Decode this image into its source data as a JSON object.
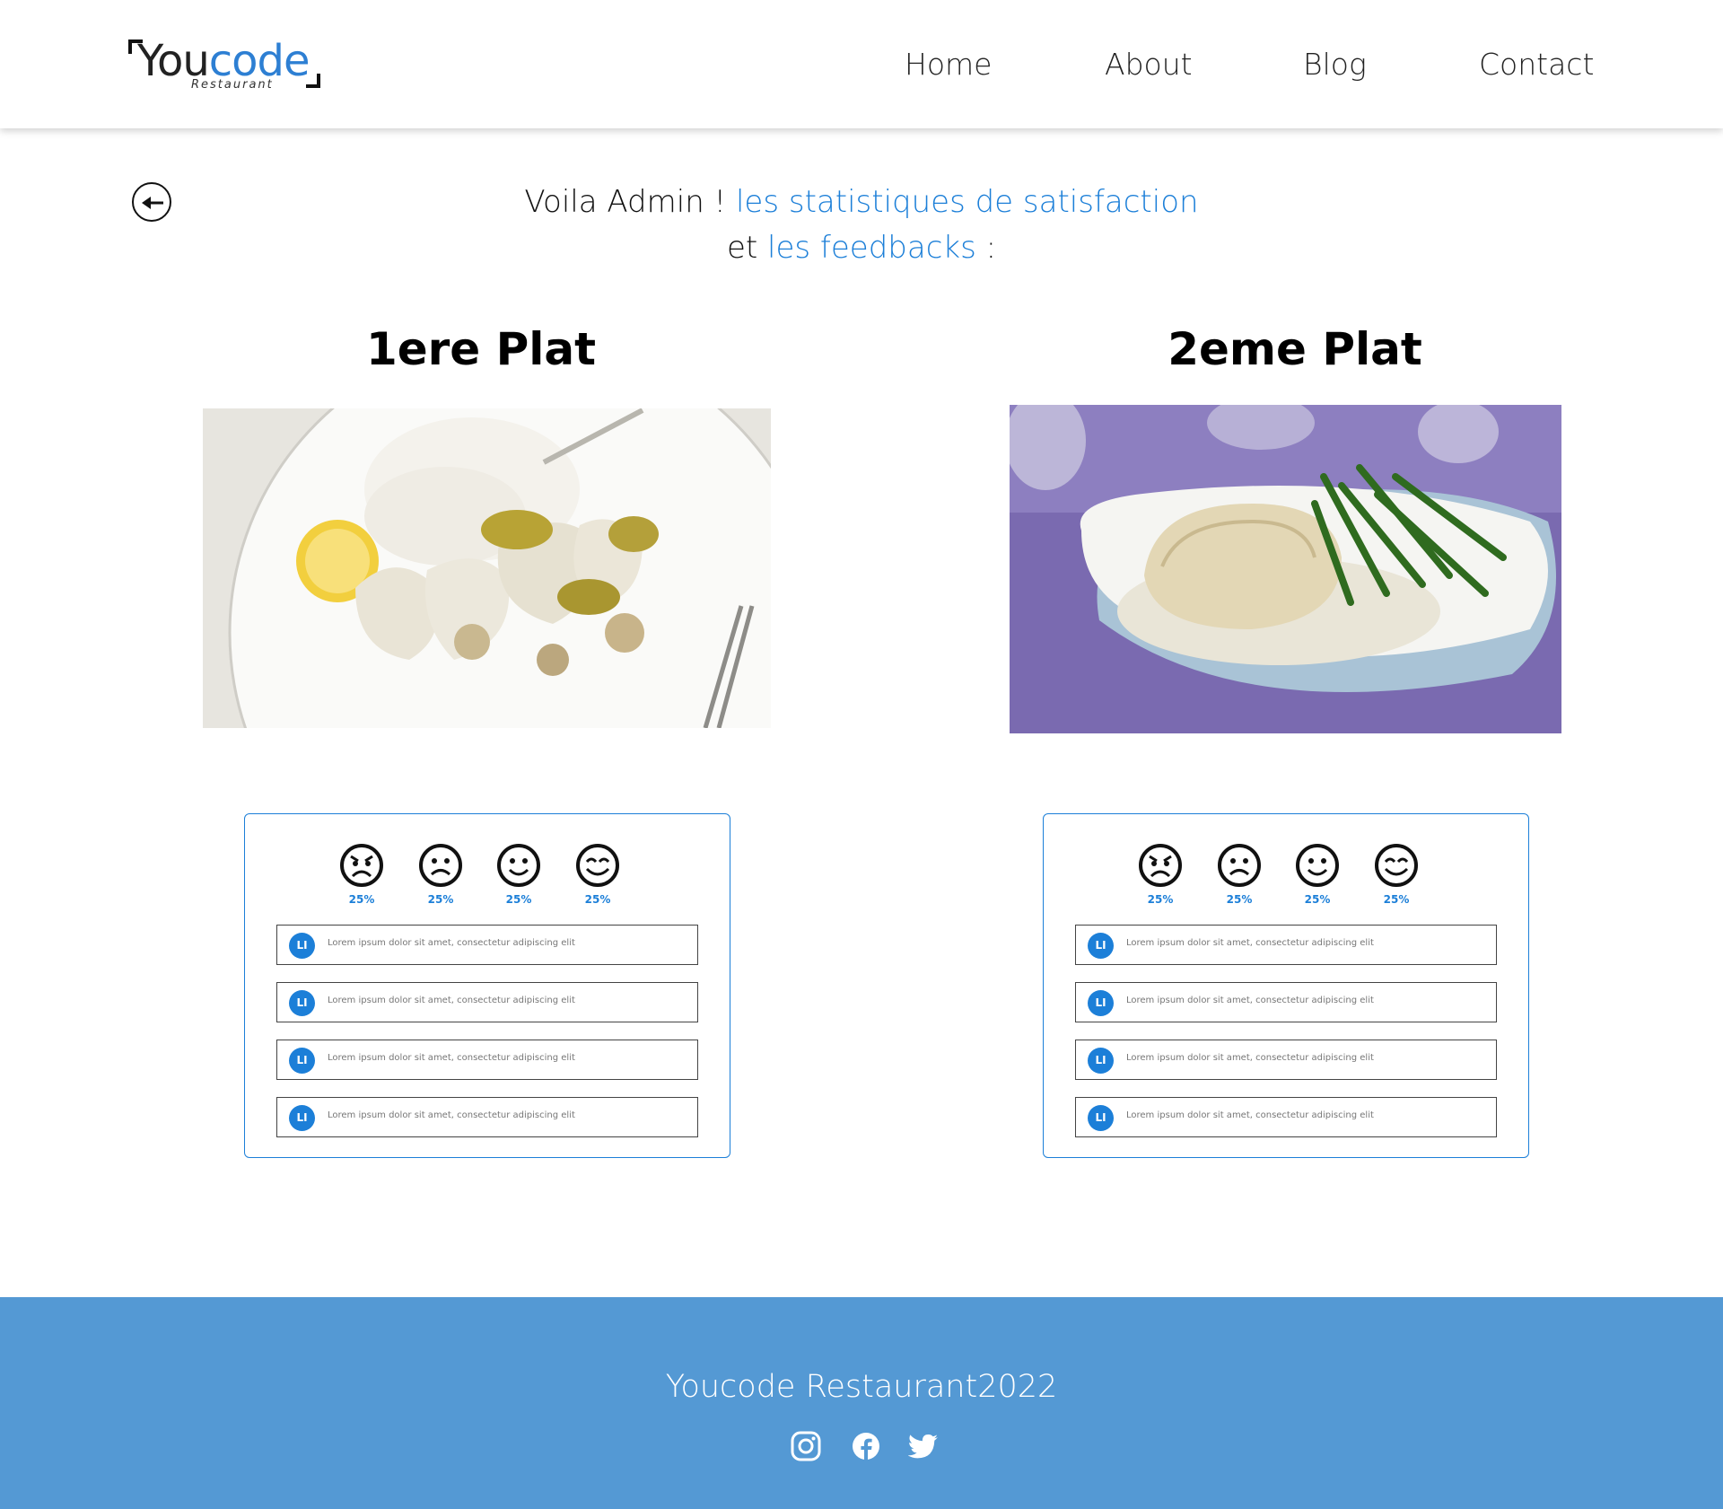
{
  "brand": {
    "name_part1": "You",
    "name_part2": "code",
    "subtitle": "Restaurant",
    "accent": "#2d7fd3"
  },
  "nav": {
    "home": "Home",
    "about": "About",
    "blog": "Blog",
    "contact": "Contact"
  },
  "intro": {
    "line1_prefix": "Voila Admin ! ",
    "line1_accent": "les statistiques de satisfaction",
    "line2_prefix": "et ",
    "line2_accent": "les feedbacks",
    "line2_suffix": " :"
  },
  "dishes": [
    {
      "title": "1ere Plat",
      "photo_icon": "chicken-rice-dish-photo",
      "ratings": [
        {
          "icon": "angry-face-icon",
          "percent": "25%"
        },
        {
          "icon": "sad-face-icon",
          "percent": "25%"
        },
        {
          "icon": "smile-face-icon",
          "percent": "25%"
        },
        {
          "icon": "happy-face-icon",
          "percent": "25%"
        }
      ],
      "feedbacks": [
        {
          "initials": "LI",
          "text": "Lorem ipsum dolor sit amet, consectetur adipiscing elit"
        },
        {
          "initials": "LI",
          "text": "Lorem ipsum dolor sit amet, consectetur adipiscing elit"
        },
        {
          "initials": "LI",
          "text": "Lorem ipsum dolor sit amet, consectetur adipiscing elit"
        },
        {
          "initials": "LI",
          "text": "Lorem ipsum dolor sit amet, consectetur adipiscing elit"
        }
      ]
    },
    {
      "title": "2eme Plat",
      "photo_icon": "chicken-green-beans-dish-photo",
      "ratings": [
        {
          "icon": "angry-face-icon",
          "percent": "25%"
        },
        {
          "icon": "sad-face-icon",
          "percent": "25%"
        },
        {
          "icon": "smile-face-icon",
          "percent": "25%"
        },
        {
          "icon": "happy-face-icon",
          "percent": "25%"
        }
      ],
      "feedbacks": [
        {
          "initials": "LI",
          "text": "Lorem ipsum dolor sit amet, consectetur adipiscing elit"
        },
        {
          "initials": "LI",
          "text": "Lorem ipsum dolor sit amet, consectetur adipiscing elit"
        },
        {
          "initials": "LI",
          "text": "Lorem ipsum dolor sit amet, consectetur adipiscing elit"
        },
        {
          "initials": "LI",
          "text": "Lorem ipsum dolor sit amet, consectetur adipiscing elit"
        }
      ]
    }
  ],
  "footer": {
    "title": "Youcode Restaurant2022",
    "socials": [
      "instagram-icon",
      "facebook-icon",
      "twitter-icon"
    ],
    "background": "#5499d4"
  }
}
